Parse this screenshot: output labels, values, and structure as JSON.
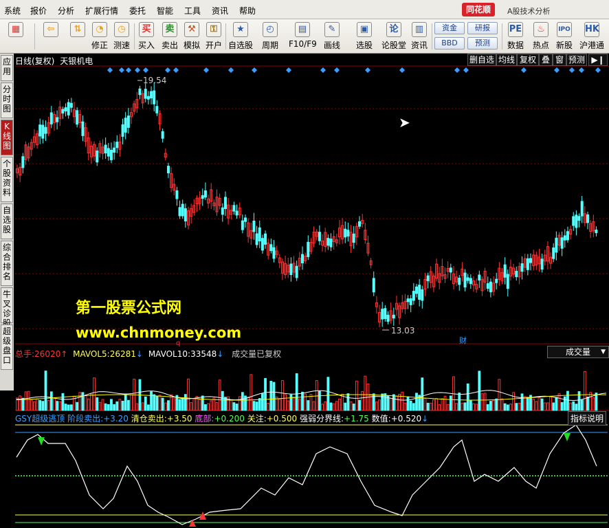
{
  "menu": [
    "系统",
    "报价",
    "分析",
    "扩展行情",
    "委托",
    "智能",
    "工具",
    "资讯",
    "帮助"
  ],
  "brand": "同花顺",
  "brand_sub": "A股技术分析",
  "toolbar": {
    "buttons": [
      {
        "label": "",
        "icon": "grid-icon",
        "ch": "▦"
      },
      {
        "label": "",
        "icon": "back-arrow-icon",
        "ch": "⇦"
      },
      {
        "label": "",
        "icon": "up-down-arrow-icon",
        "ch": "⇅"
      },
      {
        "label": "修正",
        "icon": "correct-icon",
        "ch": "◔"
      },
      {
        "label": "测速",
        "icon": "clock-icon",
        "ch": "◷"
      },
      {
        "label": "买入",
        "icon": "buy-icon",
        "ch": "买"
      },
      {
        "label": "卖出",
        "icon": "sell-icon",
        "ch": "卖"
      },
      {
        "label": "模拟",
        "icon": "hammer-icon",
        "ch": "⚒"
      },
      {
        "label": "开户",
        "icon": "lock-icon",
        "ch": "⚿"
      },
      {
        "label": "自选股",
        "icon": "star-icon",
        "ch": "★"
      },
      {
        "label": "周期",
        "icon": "cycle-icon",
        "ch": "◴"
      },
      {
        "label": "F10/F9",
        "icon": "f10-icon",
        "ch": "▤"
      },
      {
        "label": "画线",
        "icon": "pencil-icon",
        "ch": "✎"
      },
      {
        "label": "选股",
        "icon": "select-stock-icon",
        "ch": "▣"
      },
      {
        "label": "论股堂",
        "icon": "forum-icon",
        "ch": "论"
      },
      {
        "label": "资讯",
        "icon": "news-icon",
        "ch": "▥"
      },
      {
        "label": "数据",
        "icon": "pe-icon",
        "ch": "PE"
      },
      {
        "label": "热点",
        "icon": "fire-icon",
        "ch": "♨"
      },
      {
        "label": "新股",
        "icon": "ipo-icon",
        "ch": "IPO"
      },
      {
        "label": "沪港通",
        "icon": "hk-sse-icon",
        "ch": "HK"
      }
    ],
    "small": [
      "资金",
      "BBD",
      "研报",
      "预测"
    ]
  },
  "left_tabs": [
    "应用",
    "分时图",
    "K线图",
    "个股资料",
    "自选股",
    "综合排名",
    "牛叉诊股",
    "超级盘口"
  ],
  "header": {
    "period": "日线(复权)",
    "stock": "天银机电"
  },
  "right_btns": [
    "删自选",
    "均线",
    "复权",
    "叠",
    "窗",
    "预测"
  ],
  "annotations": {
    "high": "19.54",
    "low": "13.03",
    "cai": "财",
    "mark": "q"
  },
  "watermark": {
    "line1": "第一股票公式网",
    "line2": "www.chnmoney.com"
  },
  "volume": {
    "label": "总手:",
    "value": "26020",
    "v_arrow": "↑",
    "mavol5_label": "MAVOL5:",
    "mavol5": "26281",
    "m5_arrow": "↓",
    "mavol10_label": "MAVOL10:",
    "mavol10": "33548",
    "m10_arrow": "↓",
    "note": "成交量已复权",
    "dropdown": "成交量"
  },
  "indicator": {
    "name": "GSY超级逃顶",
    "p1l": "阶段卖出:",
    "p1": "+3.20",
    "p2l": "清仓卖出:",
    "p2": "+3.50",
    "p3l": "底部:",
    "p3": "+0.200",
    "p4l": "关注:",
    "p4": "+0.500",
    "p5l": "强弱分界线:",
    "p5": "+1.75",
    "p6l": "数值:",
    "p6": "+0.520",
    "p6_arrow": "↓",
    "help": "指标说明"
  },
  "colors": {
    "up": "#ff3333",
    "down": "#54ffff",
    "bg": "#000000",
    "grid": "#8b0000",
    "ma5": "#ffffff",
    "ma10": "#ffff00"
  }
}
